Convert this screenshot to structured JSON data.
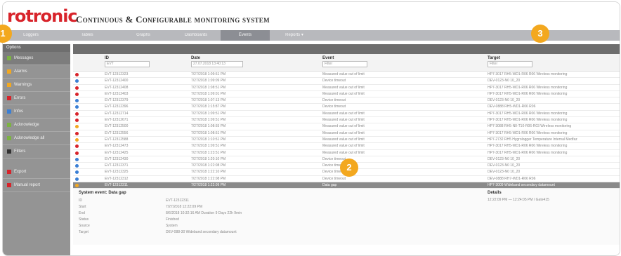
{
  "app": {
    "logo": "rotronic",
    "title": "Continuous & Configurable monitoring system"
  },
  "nav": [
    {
      "label": "Loggers"
    },
    {
      "label": "Tables"
    },
    {
      "label": "Graphs"
    },
    {
      "label": "Dashboards"
    },
    {
      "label": "Events"
    },
    {
      "label": "Reports"
    }
  ],
  "sidebar": {
    "header": "Options",
    "items": [
      {
        "label": "Messages",
        "color": "#7cb342"
      },
      {
        "label": "Alarms",
        "color": "#f3a81f"
      },
      {
        "label": "Warnings",
        "color": "#f3a81f"
      },
      {
        "label": "Errors",
        "color": "#d8232a"
      },
      {
        "label": "Infos",
        "color": "#3a7fd5"
      },
      {
        "label": "Acknowledge",
        "color": "#7cb342"
      },
      {
        "label": "Acknowledge all",
        "color": "#7cb342"
      },
      {
        "label": "Filters",
        "color": "#333333"
      }
    ],
    "extra": [
      {
        "label": "Export",
        "color": "#d8232a"
      },
      {
        "label": "Manual report",
        "color": "#d8232a"
      }
    ]
  },
  "filters": {
    "id": {
      "label": "ID",
      "value": "EVT"
    },
    "date": {
      "label": "Date",
      "value": "27.07.2018 13:40:13"
    },
    "event": {
      "label": "Event",
      "value": "Filter"
    },
    "target": {
      "label": "Target",
      "value": "Filter"
    }
  },
  "rows": [
    {
      "id": "EVT-12312323",
      "date": "7/27/2018 1:09:51 PM",
      "event": "Measured value out of limit",
      "target": "HP7-3017 RH5-WD1-R06 R06 Wireless monitoring",
      "color": "#d8232a"
    },
    {
      "id": "EVT-12312400",
      "date": "7/27/2018 1:09:09 PM",
      "event": "Device timeout",
      "target": "DEV-0123-N0 10_20",
      "color": "#3a7fd5"
    },
    {
      "id": "EVT-12312408",
      "date": "7/27/2018 1:08:51 PM",
      "event": "Measured value out of limit",
      "target": "HP7-3017 RH5-WD1-R06 R06 Wireless monitoring",
      "color": "#d8232a"
    },
    {
      "id": "EVT-12312403",
      "date": "7/27/2018 1:09:01 PM",
      "event": "Measured value out of limit",
      "target": "HP7-3017 RH5-WD1-R06 R06 Wireless monitoring",
      "color": "#d8232a"
    },
    {
      "id": "EVT-12312379",
      "date": "7/27/2018 1:07:13 PM",
      "event": "Device timeout",
      "target": "DEV-0123-N0 10_20",
      "color": "#3a7fd5"
    },
    {
      "id": "EVT-12312396",
      "date": "7/27/2018 1:15:87 PM",
      "event": "Device timeout",
      "target": "DEV-0888 RH5-WD1-R06 R06",
      "color": "#3a7fd5"
    },
    {
      "id": "EVT-12312714",
      "date": "7/27/2018 1:09:51 PM",
      "event": "Measured value out of limit",
      "target": "HP7-3017 RH5-WD1-R06 R06 Wireless monitoring",
      "color": "#d8232a"
    },
    {
      "id": "EVT-12312671",
      "date": "7/27/2018 1:09:51 PM",
      "event": "Measured value out of limit",
      "target": "HP7-3017 RH5-WD1-R06 R06 Wireless monitoring",
      "color": "#d8232a"
    },
    {
      "id": "EVT-12312500",
      "date": "7/27/2018 1:08:55 PM",
      "event": "Measured value out of limit",
      "target": "HP7-3088 RH5-N0-T10-R06-R03 Wireless monitoring",
      "color": "#f3a81f"
    },
    {
      "id": "EVT-12312556",
      "date": "7/27/2018 1:08:51 PM",
      "event": "Measured value out of limit",
      "target": "HP7-3017 RH5-WD1-R06 R06 Wireless monitoring",
      "color": "#d8232a"
    },
    {
      "id": "EVT-12312588",
      "date": "7/27/2018 1:10:51 PM",
      "event": "Measured value out of limit",
      "target": "HP7-2732 RH5 Hygrologger Temperature Internal Medfaz",
      "color": "#f3a81f"
    },
    {
      "id": "EVT-12312473",
      "date": "7/27/2018 1:09:51 PM",
      "event": "Measured value out of limit",
      "target": "HP7-3017 RH5-WD1-R06 R06 Wireless monitoring",
      "color": "#d8232a"
    },
    {
      "id": "EVT-12312425",
      "date": "7/27/2018 1:23:51 PM",
      "event": "Measured value out of limit",
      "target": "HP7-3017 RH5-WD1-R06 R06 Wireless monitoring",
      "color": "#d8232a"
    },
    {
      "id": "EVT-12312430",
      "date": "7/27/2018 1:20:10 PM",
      "event": "Device timeout",
      "target": "DEV-0123-N0 10_20",
      "color": "#3a7fd5"
    },
    {
      "id": "EVT-12312371",
      "date": "7/27/2018 1:22:08 PM",
      "event": "Device timeout",
      "target": "DEV-0123-N0 10_20",
      "color": "#3a7fd5"
    },
    {
      "id": "EVT-12312325",
      "date": "7/27/2018 1:22:10 PM",
      "event": "Device timeout",
      "target": "DEV-0123-N0 10_20",
      "color": "#3a7fd5"
    },
    {
      "id": "EVT-12312312",
      "date": "7/27/2018 1:22:08 PM",
      "event": "Device timeout",
      "target": "DEV-0888 RH7-WD1-R06 R06",
      "color": "#3a7fd5"
    },
    {
      "id": "EVT-12312311",
      "date": "7/27/2018 1:22:09 PM",
      "event": "Data gap",
      "target": "HP7-3009 Wideband secondary datamount",
      "color": "#f3a81f",
      "selected": true
    }
  ],
  "details": {
    "title": "System event: Data gap",
    "side_title": "Details",
    "side_value": "12:22:09 PM — 12:24:05 PM / Gate415",
    "fields": [
      {
        "key": "ID",
        "value": "EVT-12312311"
      },
      {
        "key": "Start",
        "value": "7/27/2018 12:22:09 PM"
      },
      {
        "key": "End",
        "value": "8/6/2018 10:32:16 AM Duration 9 Days 22h 9min"
      },
      {
        "key": "Status",
        "value": "Finished"
      },
      {
        "key": "Source",
        "value": "System"
      },
      {
        "key": "Target",
        "value": "DEV-088-30 Wideband secondary datamount"
      }
    ]
  },
  "badges": [
    "1",
    "2",
    "3"
  ]
}
